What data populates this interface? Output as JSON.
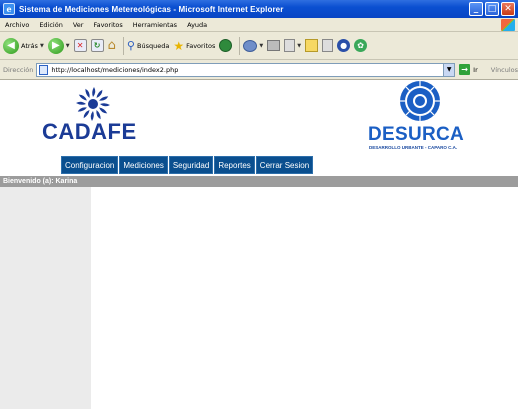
{
  "window": {
    "title": "Sistema de Mediciones Metereológicas - Microsoft Internet Explorer",
    "buttons": [
      "_",
      "□",
      "✕"
    ]
  },
  "menubar": {
    "items": [
      "Archivo",
      "Edición",
      "Ver",
      "Favoritos",
      "Herramientas",
      "Ayuda"
    ]
  },
  "toolbar": {
    "back_label": "Atrás",
    "search_label": "Búsqueda",
    "favorites_label": "Favoritos"
  },
  "address": {
    "label": "Dirección",
    "url": "http://localhost/mediciones/index2.php",
    "go_label": "Ir",
    "links_label": "Vínculos"
  },
  "header": {
    "left_logo_text": "CADAFE",
    "right_logo_text": "DESURCA",
    "right_logo_subtitle": "DESARROLLO URBANTE - CAPARO C.A.",
    "colors": {
      "cadafe_blue": "#1b3b96",
      "desurca_blue": "#1b5fc4"
    }
  },
  "nav": {
    "items": [
      "Configuracion",
      "Mediciones",
      "Seguridad",
      "Reportes",
      "Cerrar Sesion"
    ],
    "color": "#0a4f8f"
  },
  "welcome_text": "Bienvenido (a): Karina"
}
